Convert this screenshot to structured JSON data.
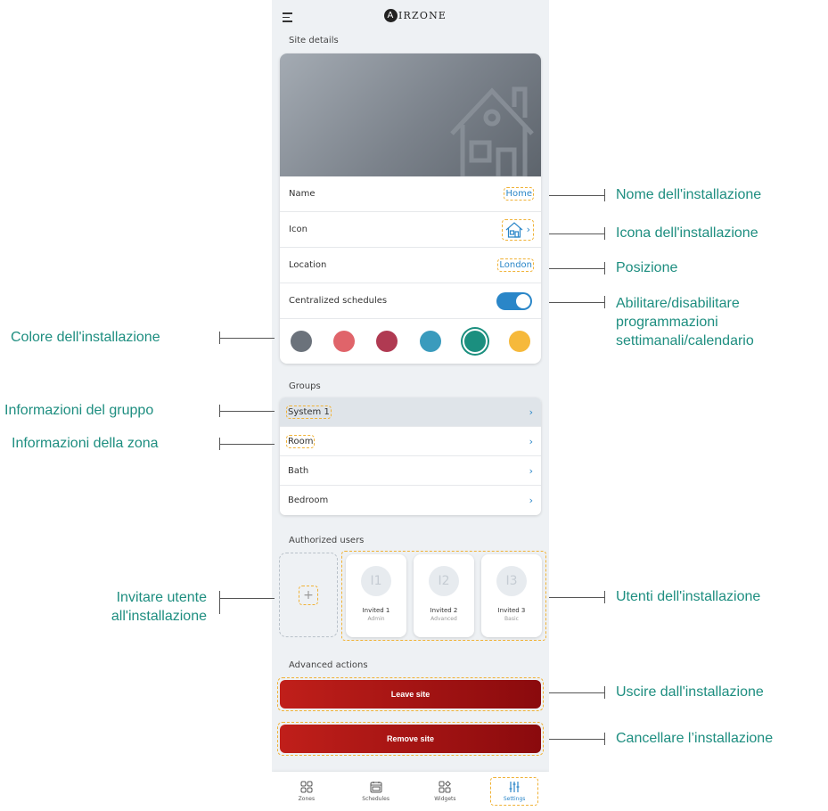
{
  "app": {
    "logo_text": "IRZONE",
    "logo_mark": "A"
  },
  "site_details": {
    "title": "Site details",
    "rows": {
      "name_label": "Name",
      "name_value": "Home",
      "icon_label": "Icon",
      "location_label": "Location",
      "location_value": "London",
      "centralized_label": "Centralized schedules",
      "centralized_on": true
    },
    "colors": [
      "#6b727b",
      "#e0646a",
      "#b03a52",
      "#3a9bbd",
      "#1b8f7f",
      "#f6b93b"
    ],
    "selected_color_index": 4
  },
  "groups": {
    "title": "Groups",
    "items": [
      {
        "label": "System 1"
      },
      {
        "label": "Room"
      },
      {
        "label": "Bath"
      },
      {
        "label": "Bedroom"
      }
    ]
  },
  "authorized_users": {
    "title": "Authorized users",
    "add_symbol": "+",
    "users": [
      {
        "initials": "I1",
        "name": "Invited 1",
        "role": "Admin"
      },
      {
        "initials": "I2",
        "name": "Invited 2",
        "role": "Advanced"
      },
      {
        "initials": "I3",
        "name": "Invited 3",
        "role": "Basic"
      }
    ]
  },
  "advanced_actions": {
    "title": "Advanced actions",
    "leave_label": "Leave site",
    "remove_label": "Remove site"
  },
  "bottom_nav": [
    {
      "label": "Zones"
    },
    {
      "label": "Schedules"
    },
    {
      "label": "Widgets"
    },
    {
      "label": "Settings"
    }
  ],
  "annotations": {
    "name": "Nome dell'installazione",
    "icon": "Icona dell'installazione",
    "location": "Posizione",
    "schedules_line1": "Abilitare/disabilitare",
    "schedules_line2": "programmazioni",
    "schedules_line3": "settimanali/calendario",
    "color": "Colore dell'installazione",
    "group_info": "Informazioni del gruppo",
    "zone_info": "Informazioni della zona",
    "invite_line1": "Invitare utente",
    "invite_line2": "all'installazione",
    "users": "Utenti dell'installazione",
    "leave": "Uscire dall'installazione",
    "remove": "Cancellare l’installazione"
  }
}
